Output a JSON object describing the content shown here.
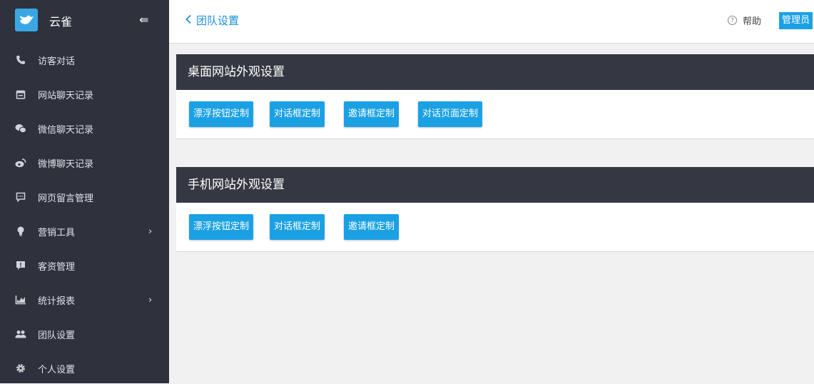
{
  "sidebar": {
    "brand": "云雀",
    "items": [
      {
        "label": "访客对话",
        "icon": "phone-icon"
      },
      {
        "label": "网站聊天记录",
        "icon": "calendar-icon"
      },
      {
        "label": "微信聊天记录",
        "icon": "wechat-icon"
      },
      {
        "label": "微博聊天记录",
        "icon": "weibo-icon"
      },
      {
        "label": "网页留言管理",
        "icon": "message-icon"
      },
      {
        "label": "营销工具",
        "icon": "lightbulb-icon",
        "arrow": "›"
      },
      {
        "label": "客资管理",
        "icon": "alert-message-icon"
      },
      {
        "label": "统计报表",
        "icon": "chart-icon",
        "arrow": "›"
      },
      {
        "label": "团队设置",
        "icon": "team-icon"
      },
      {
        "label": "个人设置",
        "icon": "gear-icon"
      }
    ]
  },
  "header": {
    "back_label": "团队设置",
    "help_label": "帮助",
    "user_label": "管理员"
  },
  "sections": [
    {
      "title": "桌面网站外观设置",
      "buttons": [
        "漂浮按钮定制",
        "对话框定制",
        "邀请框定制",
        "对话页面定制"
      ]
    },
    {
      "title": "手机网站外观设置",
      "buttons": [
        "漂浮按钮定制",
        "对话框定制",
        "邀请框定制"
      ]
    }
  ],
  "colors": {
    "sidebar": "#2f323d",
    "accent": "#1ba1e3",
    "section_header": "#353842"
  }
}
